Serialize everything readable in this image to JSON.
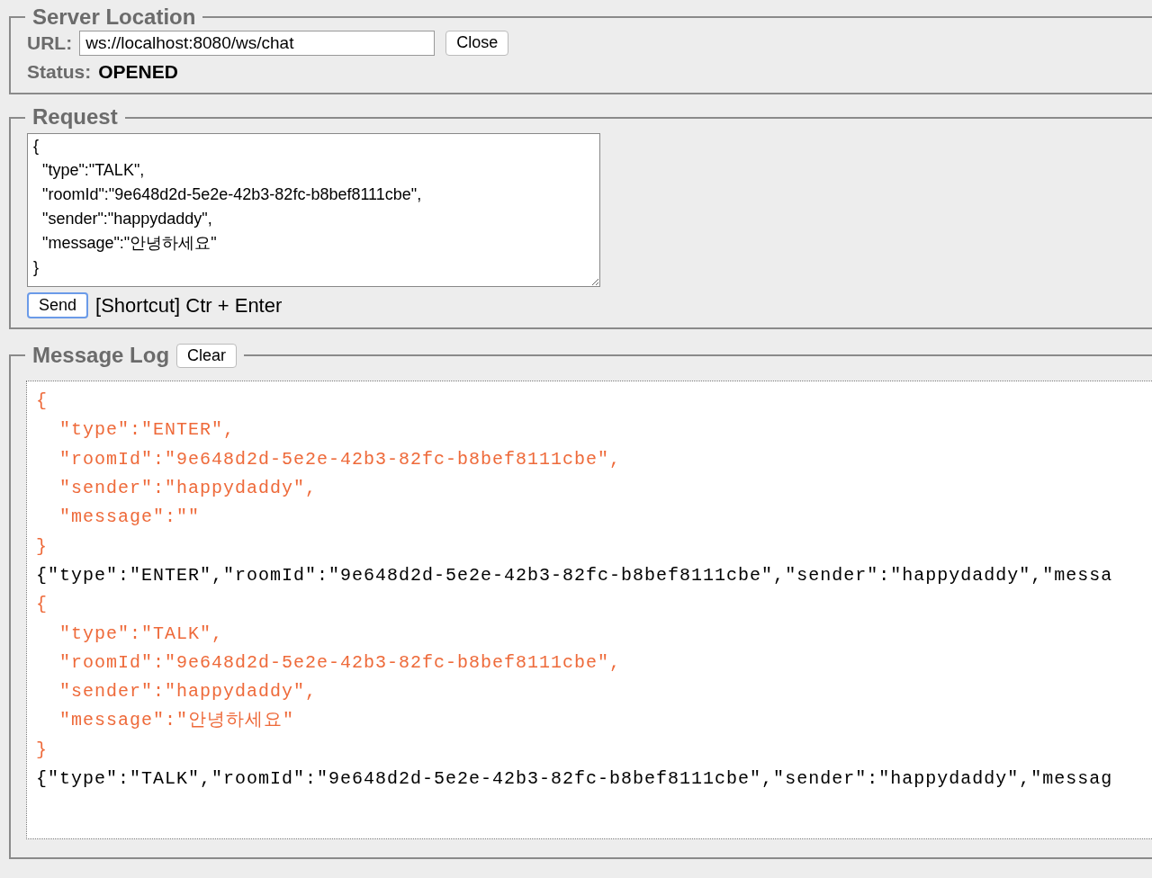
{
  "server_location": {
    "legend": "Server Location",
    "url_label": "URL:",
    "url": "ws://localhost:8080/ws/chat",
    "close_button": "Close",
    "status_label": "Status:",
    "status": "OPENED"
  },
  "request": {
    "legend": "Request",
    "body": "{\n  \"type\":\"TALK\",\n  \"roomId\":\"9e648d2d-5e2e-42b3-82fc-b8bef8111cbe\",\n  \"sender\":\"happydaddy\",\n  \"message\":\"안녕하세요\"\n}",
    "send_button": "Send",
    "send_focused": true,
    "shortcut_hint": "[Shortcut] Ctr + Enter"
  },
  "message_log": {
    "legend": "Message Log",
    "clear_button": "Clear",
    "entries": [
      {
        "kind": "pretty",
        "lines": [
          "{",
          "  \"type\":\"ENTER\",",
          "  \"roomId\":\"9e648d2d-5e2e-42b3-82fc-b8bef8111cbe\",",
          "  \"sender\":\"happydaddy\",",
          "  \"message\":\"\"",
          "}"
        ]
      },
      {
        "kind": "raw",
        "lines": [
          "{\"type\":\"ENTER\",\"roomId\":\"9e648d2d-5e2e-42b3-82fc-b8bef8111cbe\",\"sender\":\"happydaddy\",\"messa"
        ]
      },
      {
        "kind": "pretty",
        "lines": [
          "{",
          "  \"type\":\"TALK\",",
          "  \"roomId\":\"9e648d2d-5e2e-42b3-82fc-b8bef8111cbe\",",
          "  \"sender\":\"happydaddy\",",
          "  \"message\":\"안녕하세요\"",
          "}"
        ]
      },
      {
        "kind": "raw",
        "lines": [
          "{\"type\":\"TALK\",\"roomId\":\"9e648d2d-5e2e-42b3-82fc-b8bef8111cbe\",\"sender\":\"happydaddy\",\"messag"
        ]
      }
    ]
  }
}
